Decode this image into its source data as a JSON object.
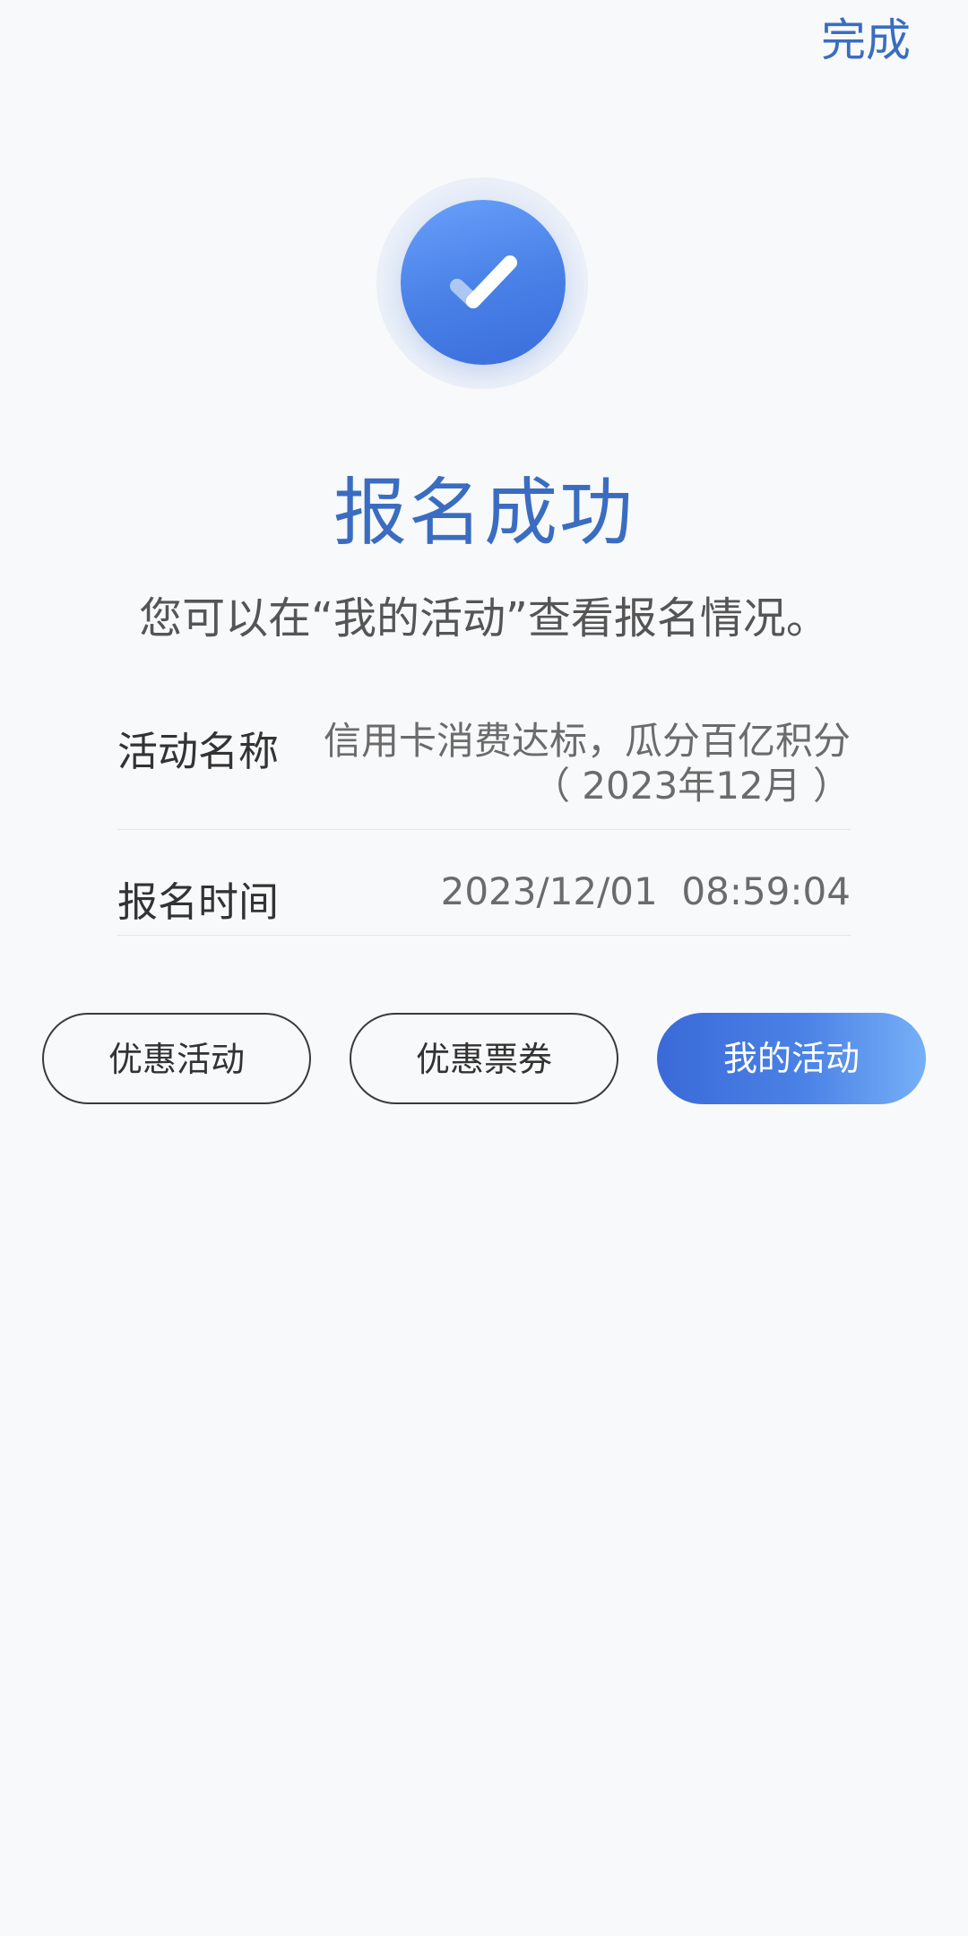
{
  "header": {
    "done_label": "完成"
  },
  "status": {
    "title": "报名成功",
    "message": "您可以在“我的活动”查看报名情况。"
  },
  "details": {
    "name_label": "活动名称",
    "name_value_line1": "信用卡消费达标，瓜分百亿积分",
    "name_value_line2": "（ 2023年12月 ）",
    "time_label": "报名时间",
    "time_value": "2023/12/01  08:59:04"
  },
  "actions": {
    "btn1": "优惠活动",
    "btn2": "优惠票券",
    "btn3": "我的活动"
  },
  "colors": {
    "accent": "#3a6dc1",
    "check_blue": "#4a82e8",
    "background": "#f8f9fa"
  },
  "icons": {
    "success": "check-circle-icon"
  }
}
